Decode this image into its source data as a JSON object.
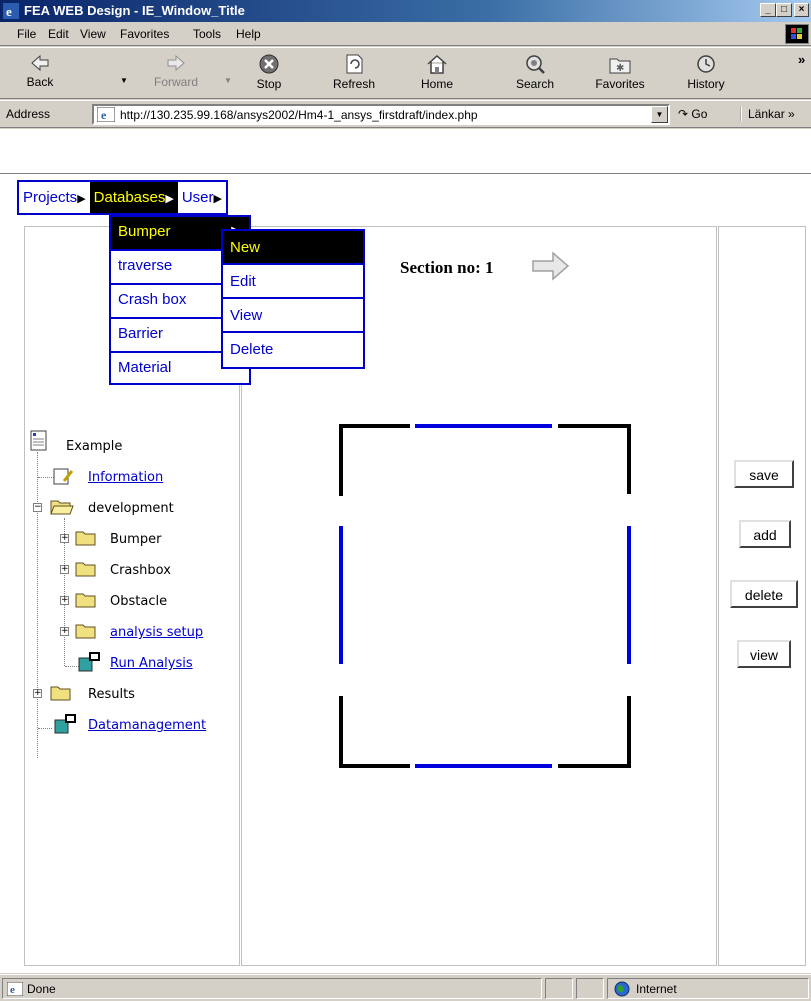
{
  "window": {
    "title": "FEA WEB Design - IE_Window_Title",
    "min": "_",
    "max": "□",
    "close": "×"
  },
  "menubar": {
    "items": [
      "File",
      "Edit",
      "View",
      "Favorites",
      "Tools",
      "Help"
    ]
  },
  "toolbar": {
    "back": "Back",
    "forward": "Forward",
    "stop": "Stop",
    "refresh": "Refresh",
    "home": "Home",
    "search": "Search",
    "favorites": "Favorites",
    "history": "History",
    "more": "»"
  },
  "addressbar": {
    "label": "Address",
    "url": "http://130.235.99.168/ansys2002/Hm4-1_ansys_firstdraft/index.php",
    "go": "Go",
    "links": "Länkar »"
  },
  "webmenu": {
    "items": [
      "Projects",
      "Databases",
      "User"
    ],
    "active": "Databases"
  },
  "databases_menu": {
    "items": [
      "Bumper",
      "traverse",
      "Crash box",
      "Barrier",
      "Material"
    ],
    "active": "Bumper"
  },
  "bumper_submenu": {
    "items": [
      "New",
      "Edit",
      "View",
      "Delete"
    ],
    "active": "New"
  },
  "tree": {
    "root": "Example",
    "information": "Information",
    "development": "development",
    "bumper": "Bumper",
    "crashbox": "Crashbox",
    "obstacle": "Obstacle",
    "analysis_setup": "analysis setup",
    "run_analysis": "Run Analysis",
    "results": "Results",
    "datamanagement": "Datamanagement"
  },
  "section": {
    "label": "Section no: 1"
  },
  "actions": {
    "save": "save",
    "add": "add",
    "delete": "delete",
    "view": "view"
  },
  "statusbar": {
    "status": "Done",
    "zone": "Internet"
  },
  "colors": {
    "link": "#0000cc",
    "menu_active_bg": "#000000",
    "menu_active_text": "#ffff00",
    "title_bar": "#0a246a"
  }
}
